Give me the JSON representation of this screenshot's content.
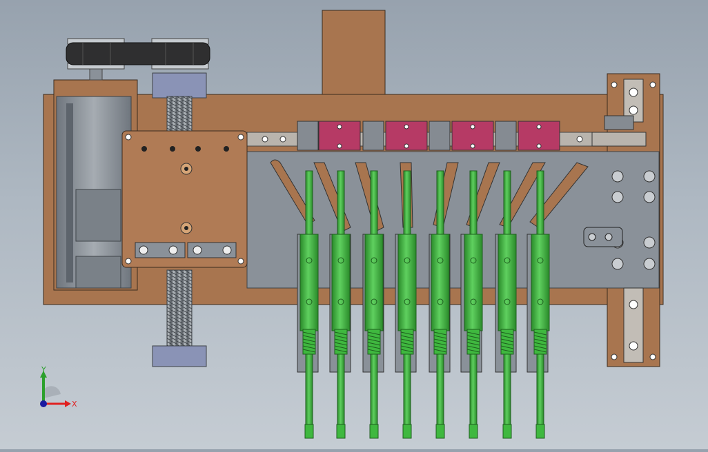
{
  "triad": {
    "x_label": "X",
    "y_label": "Y"
  },
  "colors": {
    "bronze": "#a8754f",
    "bronze_light": "#c08a60",
    "steel": "#8a9199",
    "steel_dark": "#5d646c",
    "pink": "#b63a65",
    "green": "#3fb83f",
    "green_dark": "#2a8a2a",
    "belt": "#2f2f30",
    "axis_x": "#e02020",
    "axis_y": "#2ca02c",
    "axis_z": "#1a1aa0"
  },
  "model": {
    "carriage_count": 4,
    "nozzle_count": 8
  }
}
